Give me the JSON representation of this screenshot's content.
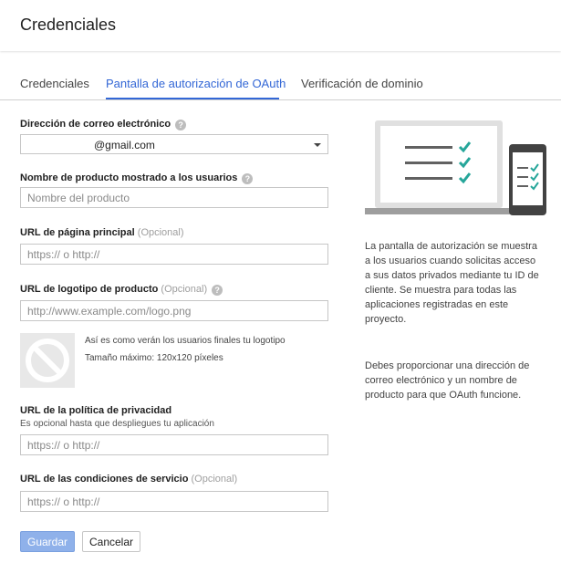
{
  "header": {
    "title": "Credenciales"
  },
  "tabs": [
    {
      "label": "Credenciales"
    },
    {
      "label": "Pantalla de autorización de OAuth"
    },
    {
      "label": "Verificación de dominio"
    }
  ],
  "form": {
    "email": {
      "label": "Dirección de correo electrónico",
      "value": "@gmail.com"
    },
    "product_name": {
      "label": "Nombre de producto mostrado a los usuarios",
      "placeholder": "Nombre del producto"
    },
    "homepage_url": {
      "label": "URL de página principal",
      "optional": "(Opcional)",
      "placeholder": "https:// o http://"
    },
    "logo_url": {
      "label": "URL de logotipo de producto",
      "optional": "(Opcional)",
      "placeholder": "http://www.example.com/logo.png"
    },
    "logo_preview": {
      "note": "Así es como verán los usuarios finales tu logotipo",
      "max_size": "Tamaño máximo: 120x120 píxeles"
    },
    "privacy_url": {
      "label": "URL de la política de privacidad",
      "sublabel": "Es opcional hasta que despliegues tu aplicación",
      "placeholder": "https:// o http://"
    },
    "terms_url": {
      "label": "URL de las condiciones de servicio",
      "optional": "(Opcional)",
      "placeholder": "https:// o http://"
    },
    "help_glyph": "?"
  },
  "buttons": {
    "save": "Guardar",
    "cancel": "Cancelar"
  },
  "sidebar": {
    "paragraph1": "La pantalla de autorización se muestra a los usuarios cuando solicitas acceso a sus datos privados mediante tu ID de cliente. Se muestra para todas las aplicaciones registradas en este proyecto.",
    "paragraph2": "Debes proporcionar una dirección de correo electrónico y un nombre de producto para que OAuth funcione."
  },
  "colors": {
    "accent": "#3367d6",
    "check": "#26a69a",
    "save_button": "#8fb1ea"
  }
}
